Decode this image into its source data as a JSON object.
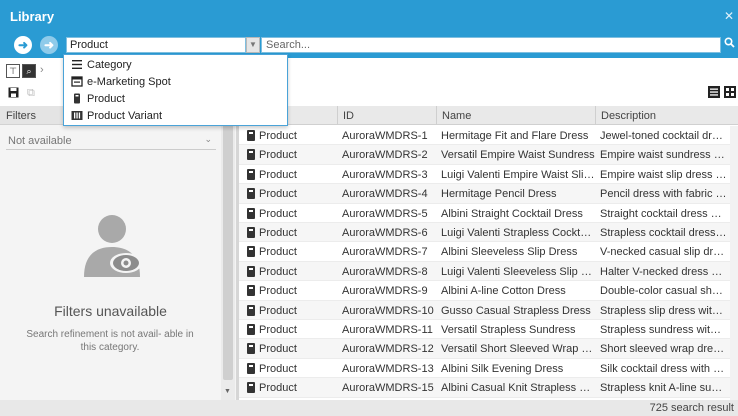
{
  "window": {
    "title": "Library",
    "close_icon": "close-icon"
  },
  "search": {
    "type_value": "Product",
    "placeholder": "Search..."
  },
  "dropdown": {
    "items": [
      {
        "label": "Category",
        "icon": "list-icon"
      },
      {
        "label": "e-Marketing Spot",
        "icon": "marketing-spot-icon"
      },
      {
        "label": "Product",
        "icon": "product-icon"
      },
      {
        "label": "Product Variant",
        "icon": "product-variant-icon"
      }
    ]
  },
  "left_panel": {
    "header": "Filters",
    "select_value": "Not available",
    "title": "Filters unavailable",
    "subtitle": "Search refinement is not avail- able in this category."
  },
  "table": {
    "columns": [
      "ID",
      "Name",
      "Description"
    ],
    "rows": [
      {
        "type": "Product",
        "id": "AuroraWMDRS-1",
        "name": "Hermitage Fit and Flare Dress",
        "desc": "Jewel-toned cocktail dres..."
      },
      {
        "type": "Product",
        "id": "AuroraWMDRS-2",
        "name": "Versatil Empire Waist Sundress",
        "desc": "Empire waist sundress wi..."
      },
      {
        "type": "Product",
        "id": "AuroraWMDRS-3",
        "name": "Luigi Valenti Empire Waist Slip ...",
        "desc": "Empire waist slip dress w..."
      },
      {
        "type": "Product",
        "id": "AuroraWMDRS-4",
        "name": "Hermitage Pencil Dress",
        "desc": "Pencil dress with fabric d..."
      },
      {
        "type": "Product",
        "id": "AuroraWMDRS-5",
        "name": "Albini Straight Cocktail Dress",
        "desc": "Straight cocktail dress wit..."
      },
      {
        "type": "Product",
        "id": "AuroraWMDRS-6",
        "name": "Luigi Valenti Strapless Cocktail ...",
        "desc": "Strapless cocktail dress ..."
      },
      {
        "type": "Product",
        "id": "AuroraWMDRS-7",
        "name": "Albini Sleeveless Slip Dress",
        "desc": "V-necked casual slip dres..."
      },
      {
        "type": "Product",
        "id": "AuroraWMDRS-8",
        "name": "Luigi Valenti Sleeveless Slip Dre...",
        "desc": "Halter V-necked dress wit..."
      },
      {
        "type": "Product",
        "id": "AuroraWMDRS-9",
        "name": "Albini A-line Cotton Dress",
        "desc": "Double-color casual short..."
      },
      {
        "type": "Product",
        "id": "AuroraWMDRS-10",
        "name": "Gusso Casual Strapless Dress",
        "desc": "Strapless slip dress with l..."
      },
      {
        "type": "Product",
        "id": "AuroraWMDRS-11",
        "name": "Versatil Strapless Sundress",
        "desc": "Strapless sundress with s..."
      },
      {
        "type": "Product",
        "id": "AuroraWMDRS-12",
        "name": "Versatil Short Sleeved Wrap Dre...",
        "desc": "Short sleeved wrap dress ..."
      },
      {
        "type": "Product",
        "id": "AuroraWMDRS-13",
        "name": "Albini Silk Evening Dress",
        "desc": "Silk cocktail dress with pl..."
      },
      {
        "type": "Product",
        "id": "AuroraWMDRS-15",
        "name": "Albini Casual Knit Strapless Dre...",
        "desc": "Strapless knit A-line sum..."
      }
    ]
  },
  "status": {
    "results": "725 search result"
  },
  "colors": {
    "accent": "#2a9bd3"
  }
}
